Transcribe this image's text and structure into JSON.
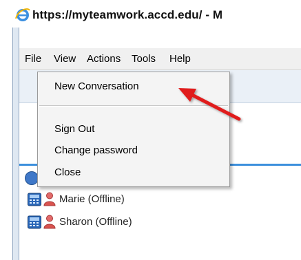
{
  "window": {
    "title": "https://myteamwork.accd.edu/ - M"
  },
  "menubar": {
    "items": [
      "File",
      "View",
      "Actions",
      "Tools",
      "Help"
    ]
  },
  "file_menu": {
    "items": [
      "New Conversation",
      "Sign Out",
      "Change password",
      "Close"
    ]
  },
  "contacts": [
    {
      "name": "Marie (Offline)",
      "status": "offline"
    },
    {
      "name": "Sharon (Offline)",
      "status": "offline"
    }
  ],
  "icons": {
    "browser": "internet-explorer-icon",
    "phone": "phone-icon",
    "person": "person-icon",
    "group": "group-icon",
    "annotation": "red-arrow-annotation"
  },
  "colors": {
    "accent_rule": "#3c8fdc",
    "arrow": "#e01e1e",
    "person_offline": "#d9534f"
  }
}
